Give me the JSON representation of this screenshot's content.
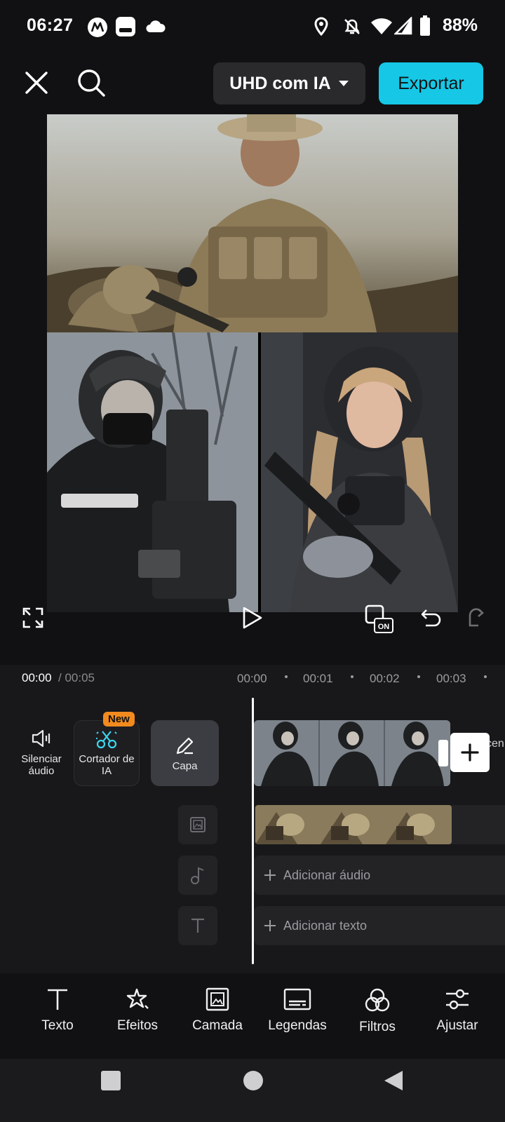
{
  "status_bar": {
    "time": "06:27",
    "battery": "88%",
    "icons": [
      "motorola-icon",
      "media-icon",
      "cloud-icon",
      "location-icon",
      "bell-off-icon",
      "wifi-icon",
      "signal-icon",
      "battery-icon"
    ]
  },
  "top_bar": {
    "quality_label": "UHD com IA",
    "export_label": "Exportar",
    "icons": [
      "close-icon",
      "search-icon",
      "caret-down-icon"
    ]
  },
  "playback": {
    "icons": [
      "fullscreen-icon",
      "play-icon",
      "on-toggle-icon",
      "undo-icon",
      "redo-icon"
    ],
    "on_label": "ON"
  },
  "timeline": {
    "current_time": "00:00",
    "total_time": "/ 00:05",
    "ruler": [
      "00:00",
      "00:01",
      "00:02",
      "00:03"
    ],
    "tools": [
      {
        "label": "Silenciar áudio",
        "icon": "speaker-icon"
      },
      {
        "label": "Cortador de IA",
        "icon": "ai-scissors-icon",
        "badge": "New"
      },
      {
        "label": "Capa",
        "icon": "pencil-icon"
      }
    ],
    "clip_overflow_text": "cen",
    "add_clip_icon": "plus-icon",
    "add_audio": "Adicionar áudio",
    "add_text": "Adicionar texto",
    "track_icons": [
      "overlay-icon",
      "music-note-icon",
      "text-icon"
    ]
  },
  "bottom_toolbar": [
    {
      "label": "Texto",
      "icon": "text-icon"
    },
    {
      "label": "Efeitos",
      "icon": "effects-star-icon"
    },
    {
      "label": "Camada",
      "icon": "layer-icon"
    },
    {
      "label": "Legendas",
      "icon": "captions-icon"
    },
    {
      "label": "Filtros",
      "icon": "filters-icon"
    },
    {
      "label": "Ajustar",
      "icon": "adjust-icon"
    }
  ],
  "nav_bar": {
    "icons": [
      "recents-square-icon",
      "home-circle-icon",
      "back-triangle-icon"
    ]
  },
  "colors": {
    "accent": "#16c7e6",
    "badge": "#f28a1e",
    "background": "#111113"
  }
}
